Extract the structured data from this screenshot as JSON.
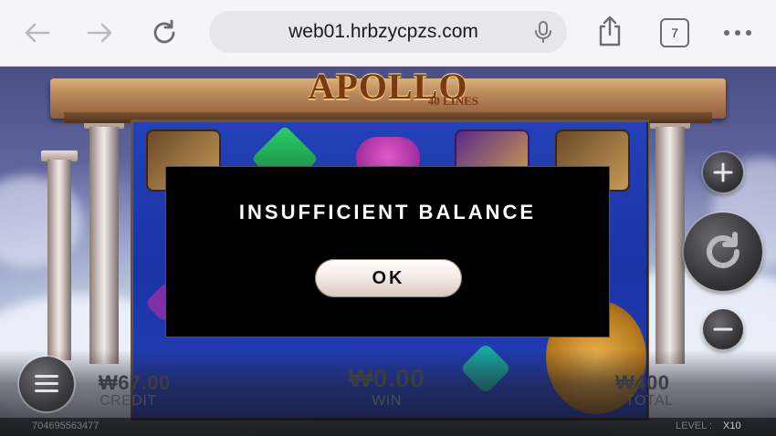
{
  "browser": {
    "url": "web01.hrbzycpzs.com",
    "tab_count": "7",
    "icons": [
      "back-arrow-icon",
      "forward-arrow-icon",
      "reload-icon",
      "microphone-icon",
      "share-icon",
      "tabs-icon",
      "more-icon"
    ]
  },
  "game": {
    "logo_title": "APOLLO",
    "logo_subtitle": "40 LINES",
    "credit_value": "₩67.00",
    "credit_label": "CREDIT",
    "win_value": "₩0.00",
    "win_label": "WIN",
    "total_value": "₩400",
    "total_label": "TOTAL",
    "session_id": "704695563477",
    "level_label": "LEVEL :",
    "level_value": "X10"
  },
  "dialog": {
    "message": "INSUFFICIENT BALANCE",
    "ok_label": "OK"
  },
  "colors": {
    "reel_blue": "#1a34a4",
    "dialog_bg": "#000000",
    "url_bar": "#e7e7eb"
  }
}
